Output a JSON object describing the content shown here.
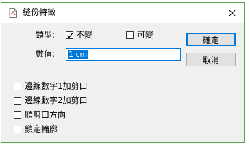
{
  "window": {
    "title": "縫份特徵"
  },
  "form": {
    "type_label": "類型:",
    "type_options": [
      {
        "label": "不變",
        "checked": true
      },
      {
        "label": "可變",
        "checked": false
      }
    ],
    "value_label": "數值:",
    "value_text": "1 cm"
  },
  "buttons": {
    "ok": "確定",
    "cancel": "取消"
  },
  "options": [
    {
      "label": "邊線數字1加剪口",
      "checked": false
    },
    {
      "label": "邊線數字2加剪口",
      "checked": false
    },
    {
      "label": "順剪口方向",
      "checked": false
    },
    {
      "label": "鎖定輪廓",
      "checked": false
    }
  ],
  "colors": {
    "accent": "#0078d7",
    "window_border": "#57a64a"
  }
}
